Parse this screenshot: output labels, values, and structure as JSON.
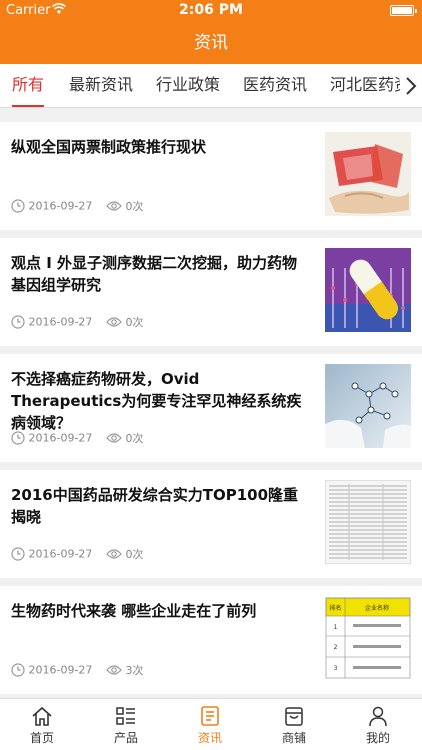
{
  "status_bar": {
    "carrier": "Carrier",
    "time": "2:06 PM"
  },
  "header": {
    "title": "资讯"
  },
  "tabs": [
    {
      "label": "所有",
      "active": true
    },
    {
      "label": "最新资讯",
      "active": false
    },
    {
      "label": "行业政策",
      "active": false
    },
    {
      "label": "医药资讯",
      "active": false
    },
    {
      "label": "河北医药资",
      "active": false
    }
  ],
  "articles": [
    {
      "title": "纵观全国两票制政策推行现状",
      "date": "2016-09-27",
      "views": "0次"
    },
    {
      "title": "观点 I 外显子测序数据二次挖掘，助力药物基因组学研究",
      "date": "2016-09-27",
      "views": "0次"
    },
    {
      "title": "不选择癌症药物研发，Ovid Therapeutics为何要专注罕见神经系统疾病领域？",
      "date": "2016-09-27",
      "views": "0次"
    },
    {
      "title": "2016中国药品研发综合实力TOP100隆重揭晓",
      "date": "2016-09-27",
      "views": "0次"
    },
    {
      "title": "生物药时代来袭 哪些企业走在了前列",
      "date": "2016-09-27",
      "views": "3次"
    }
  ],
  "thumb5": {
    "col1": "排名",
    "col2": "企业名称",
    "rows": [
      "1",
      "2",
      "3"
    ]
  },
  "tabbar": [
    {
      "label": "首页",
      "icon": "home-icon",
      "active": false
    },
    {
      "label": "产品",
      "icon": "grid-list-icon",
      "active": false
    },
    {
      "label": "资讯",
      "icon": "news-icon",
      "active": true
    },
    {
      "label": "商铺",
      "icon": "shop-icon",
      "active": false
    },
    {
      "label": "我的",
      "icon": "user-icon",
      "active": false
    }
  ],
  "colors": {
    "brand": "#f57f17",
    "active_tab": "#e03030"
  }
}
